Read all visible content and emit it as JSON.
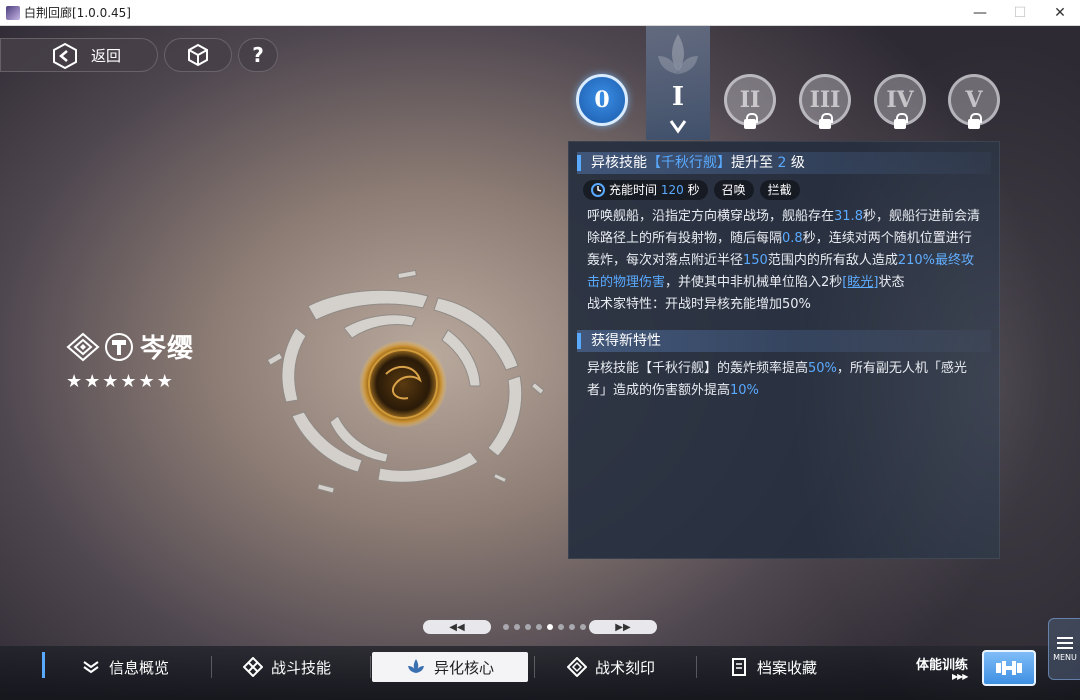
{
  "window": {
    "title": "白荆回廊[1.0.0.45]",
    "minimize_glyph": "—",
    "maximize_glyph": "☐",
    "close_glyph": "✕"
  },
  "header": {
    "back_label": "返回",
    "help_label": "?"
  },
  "level_tabs": [
    {
      "numeral": "0",
      "state": "unlocked"
    },
    {
      "numeral": "I",
      "state": "selected"
    },
    {
      "numeral": "II",
      "state": "locked"
    },
    {
      "numeral": "III",
      "state": "locked"
    },
    {
      "numeral": "IV",
      "state": "locked"
    },
    {
      "numeral": "V",
      "state": "locked"
    }
  ],
  "character": {
    "name": "岑缨",
    "stars": "★★★★★★",
    "star_count": 6
  },
  "panel": {
    "skill_head": {
      "prefix": "异核技能",
      "skill_name": "【千秋行舰】",
      "mid": "提升至",
      "level": "2",
      "suffix": "级"
    },
    "chips": {
      "charge_label": "充能时间",
      "charge_value": "120",
      "charge_unit": "秒",
      "tag1": "召唤",
      "tag2": "拦截"
    },
    "desc": {
      "p1": "呼唤舰船，沿指定方向横穿战场，舰船存在",
      "v1": "31.8",
      "p2": "秒，舰船行进前会清除路径上的所有投射物，随后每隔",
      "v2": "0.8",
      "p3": "秒，连续对两个随机位置进行轰炸，每次对落点附近半径",
      "v3": "150",
      "p4": "范围内的所有敌人造成",
      "v4": "210%最终攻击的物理伤害",
      "p5": "，并使其中非机械单位陷入2秒",
      "link": "[眩光]",
      "p6": "状态",
      "trait": "战术家特性：开战时异核充能增加50%"
    },
    "new_trait_head": "获得新特性",
    "new_trait": {
      "p1": "异核技能【千秋行舰】的轰炸频率提高",
      "v1": "50%",
      "p2": "，所有副无人机「感光者」造成的伤害额外提高",
      "v2": "10%"
    }
  },
  "pager": {
    "prev_glyph": "◀◀",
    "next_glyph": "▶▶",
    "page_count": 8,
    "current_page": 5
  },
  "nav": {
    "items": [
      {
        "label": "信息概览",
        "icon": "info-overview-icon"
      },
      {
        "label": "战斗技能",
        "icon": "combat-skill-icon"
      },
      {
        "label": "异化核心",
        "icon": "alien-core-icon",
        "active": true
      },
      {
        "label": "战术刻印",
        "icon": "tactical-imprint-icon"
      },
      {
        "label": "档案收藏",
        "icon": "archive-icon"
      }
    ],
    "fitness_label": "体能训练",
    "fitness_arrows": "▶▶▶",
    "menu_label": "MENU"
  },
  "colors": {
    "accent_blue": "#59a9ff",
    "panel_bg": "#262e3e",
    "active_tab": "#f4f4f6"
  }
}
